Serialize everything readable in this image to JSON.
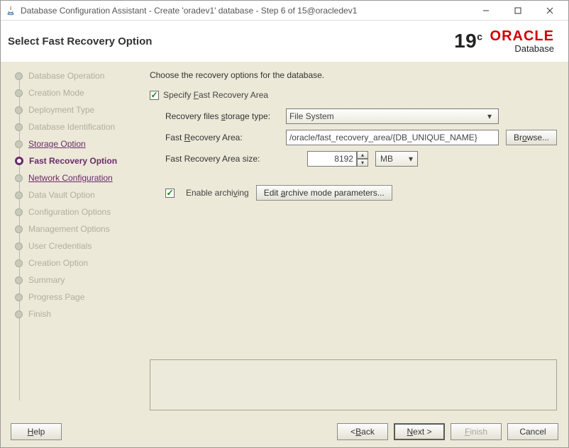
{
  "titlebar": {
    "title": "Database Configuration Assistant - Create 'oradev1' database - Step 6 of 15@oracledev1"
  },
  "header": {
    "title": "Select Fast Recovery Option",
    "version": "19",
    "version_suffix": "c",
    "brand_word": "ORACLE",
    "brand_sub": "Database"
  },
  "sidebar": {
    "steps": [
      {
        "label": "Database Operation",
        "state": "disabled"
      },
      {
        "label": "Creation Mode",
        "state": "disabled"
      },
      {
        "label": "Deployment Type",
        "state": "disabled"
      },
      {
        "label": "Database Identification",
        "state": "disabled"
      },
      {
        "label": "Storage Option",
        "state": "link"
      },
      {
        "label": "Fast Recovery Option",
        "state": "current"
      },
      {
        "label": "Network Configuration",
        "state": "link"
      },
      {
        "label": "Data Vault Option",
        "state": "disabled"
      },
      {
        "label": "Configuration Options",
        "state": "disabled"
      },
      {
        "label": "Management Options",
        "state": "disabled"
      },
      {
        "label": "User Credentials",
        "state": "disabled"
      },
      {
        "label": "Creation Option",
        "state": "disabled"
      },
      {
        "label": "Summary",
        "state": "disabled"
      },
      {
        "label": "Progress Page",
        "state": "disabled"
      },
      {
        "label": "Finish",
        "state": "disabled"
      }
    ]
  },
  "main": {
    "instruction": "Choose the recovery options for the database.",
    "specify_checkbox_label_pre": "Specify ",
    "specify_checkbox_label_u": "F",
    "specify_checkbox_label_post": "ast Recovery Area",
    "storage_label_pre": "Recovery files ",
    "storage_label_u": "s",
    "storage_label_post": "torage type:",
    "storage_value": "File System",
    "fra_label_pre": "Fast ",
    "fra_label_u": "R",
    "fra_label_post": "ecovery Area:",
    "fra_value": "/oracle/fast_recovery_area/{DB_UNIQUE_NAME}",
    "browse_label": "Browse...",
    "size_label": "Fast Recovery Area size:",
    "size_value": "8192",
    "size_unit": "MB",
    "enable_arch_label_pre": "Enable archi",
    "enable_arch_label_u": "v",
    "enable_arch_label_post": "ing",
    "edit_arch_label_pre": "Edit ",
    "edit_arch_label_u": "a",
    "edit_arch_label_post": "rchive mode parameters..."
  },
  "footer": {
    "help": "Help",
    "back": "< Back",
    "next": "Next >",
    "finish": "Finish",
    "cancel": "Cancel"
  }
}
